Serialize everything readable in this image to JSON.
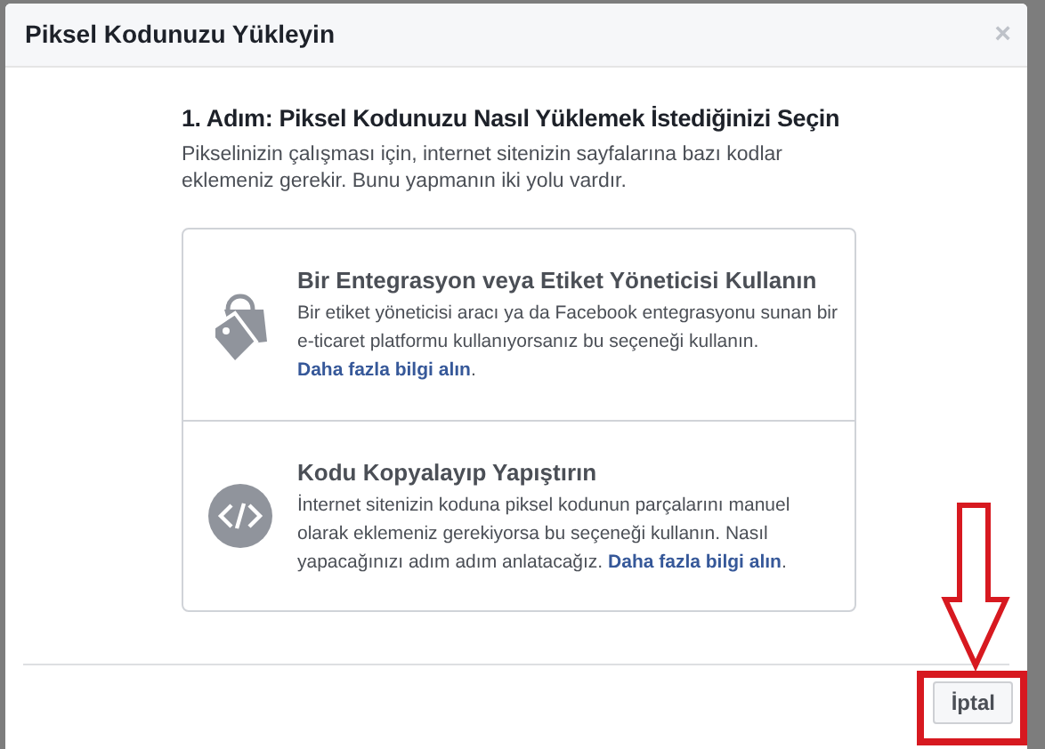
{
  "dialog": {
    "title": "Piksel Kodunuzu Yükleyin",
    "close": "×"
  },
  "step": {
    "heading": "1. Adım: Piksel Kodunuzu Nasıl Yüklemek İstediğinizi Seçin",
    "description": "Pikselinizin çalışması için, internet sitenizin sayfalarına bazı kodlar eklemeniz gerekir. Bunu yapmanın iki yolu vardır."
  },
  "options": [
    {
      "kind": "tags",
      "title": "Bir Entegrasyon veya Etiket Yöneticisi Kullanın",
      "description": "Bir etiket yöneticisi aracı ya da Facebook entegrasyonu sunan bir e-ticaret platformu kullanıyorsanız bu seçeneği kullanın.",
      "link": "Daha fazla bilgi alın",
      "suffix": "."
    },
    {
      "kind": "code",
      "title": "Kodu Kopyalayıp Yapıştırın",
      "description": "İnternet sitenizin koduna piksel kodunun parçalarını manuel olarak eklemeniz gerekiyorsa bu seçeneği kullanın. Nasıl yapacağınızı adım adım anlatacağız.",
      "link": "Daha fazla bilgi alın",
      "suffix": "."
    }
  ],
  "footer": {
    "buttons": [
      "İptal"
    ]
  },
  "annotation": {
    "arrow": true,
    "highlight": true
  }
}
